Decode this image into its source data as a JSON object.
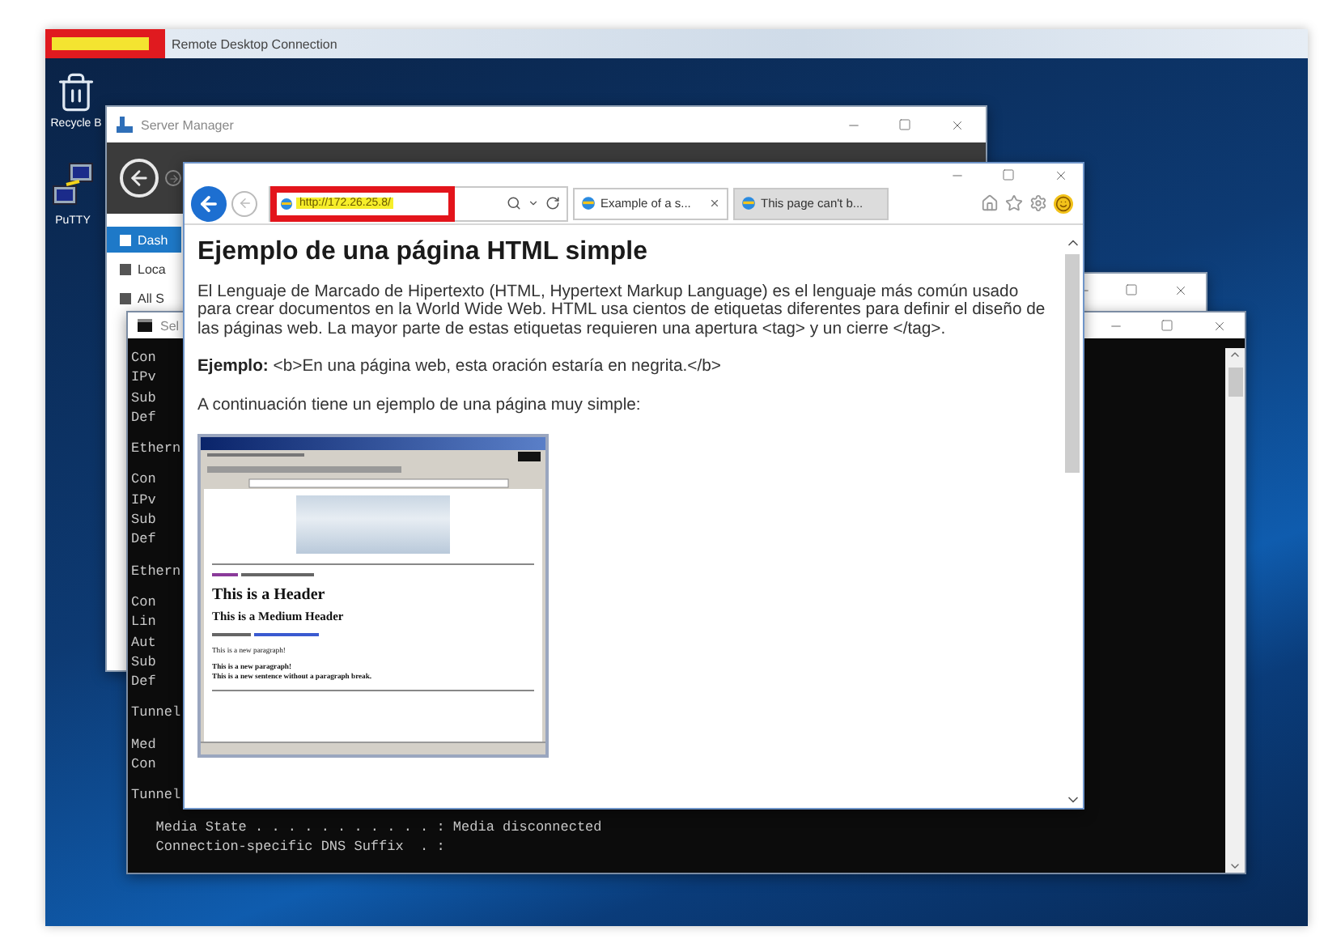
{
  "remote_session": {
    "title": "Remote Desktop Connection"
  },
  "desktop_icons": [
    {
      "label": "Recycle B",
      "kind": "recycle-bin"
    },
    {
      "label": "PuTTY",
      "kind": "putty"
    }
  ],
  "server_manager": {
    "title": "Server Manager",
    "nav_items": [
      {
        "label": "Dash",
        "selected": true
      },
      {
        "label": "Loca",
        "selected": false
      },
      {
        "label": "All S",
        "selected": false
      }
    ]
  },
  "console": {
    "title": "Sel",
    "sections": [
      [
        "Con",
        "IPv",
        "Sub",
        "Def"
      ],
      [
        "Ethern"
      ],
      [
        "Con",
        "IPv",
        "Sub",
        "Def"
      ],
      [
        "Ethern"
      ],
      [
        "Con",
        "Lin",
        "Aut",
        "Sub",
        "Def"
      ],
      [
        "Tunnel"
      ],
      [
        "Med",
        "Con"
      ],
      [
        "Tunnel"
      ],
      [
        "   Media State . . . . . . . . . . . : Media disconnected",
        "   Connection-specific DNS Suffix  . :"
      ]
    ]
  },
  "browser": {
    "address": "http://172.26.25.8/",
    "tabs": [
      {
        "label": "Example of a s...",
        "selected": true
      },
      {
        "label": "This page can't b...",
        "selected": false
      }
    ],
    "page": {
      "heading": "Ejemplo de una página HTML simple",
      "paragraphs": [
        "El Lenguaje de Marcado de Hipertexto (HTML, Hypertext Markup Language) es el lenguaje más común usado para crear documentos en la World Wide Web. HTML usa cientos de etiquetas diferentes para definir el diseño de las páginas web. La mayor parte de estas etiquetas requieren una apertura <tag> y un cierre </tag>.",
        "**Ejemplo:** <b>En una página web, esta oración estaría en negrita.</b>",
        "A continuación tiene un ejemplo de una página muy simple:"
      ],
      "example_screenshot": {
        "header": "This is a Header",
        "medium_header": "This is a Medium Header",
        "paragraph": "This is a new paragraph!",
        "bold_lines": [
          "This is a new paragraph!",
          "This is a new sentence without a paragraph break."
        ]
      }
    }
  }
}
